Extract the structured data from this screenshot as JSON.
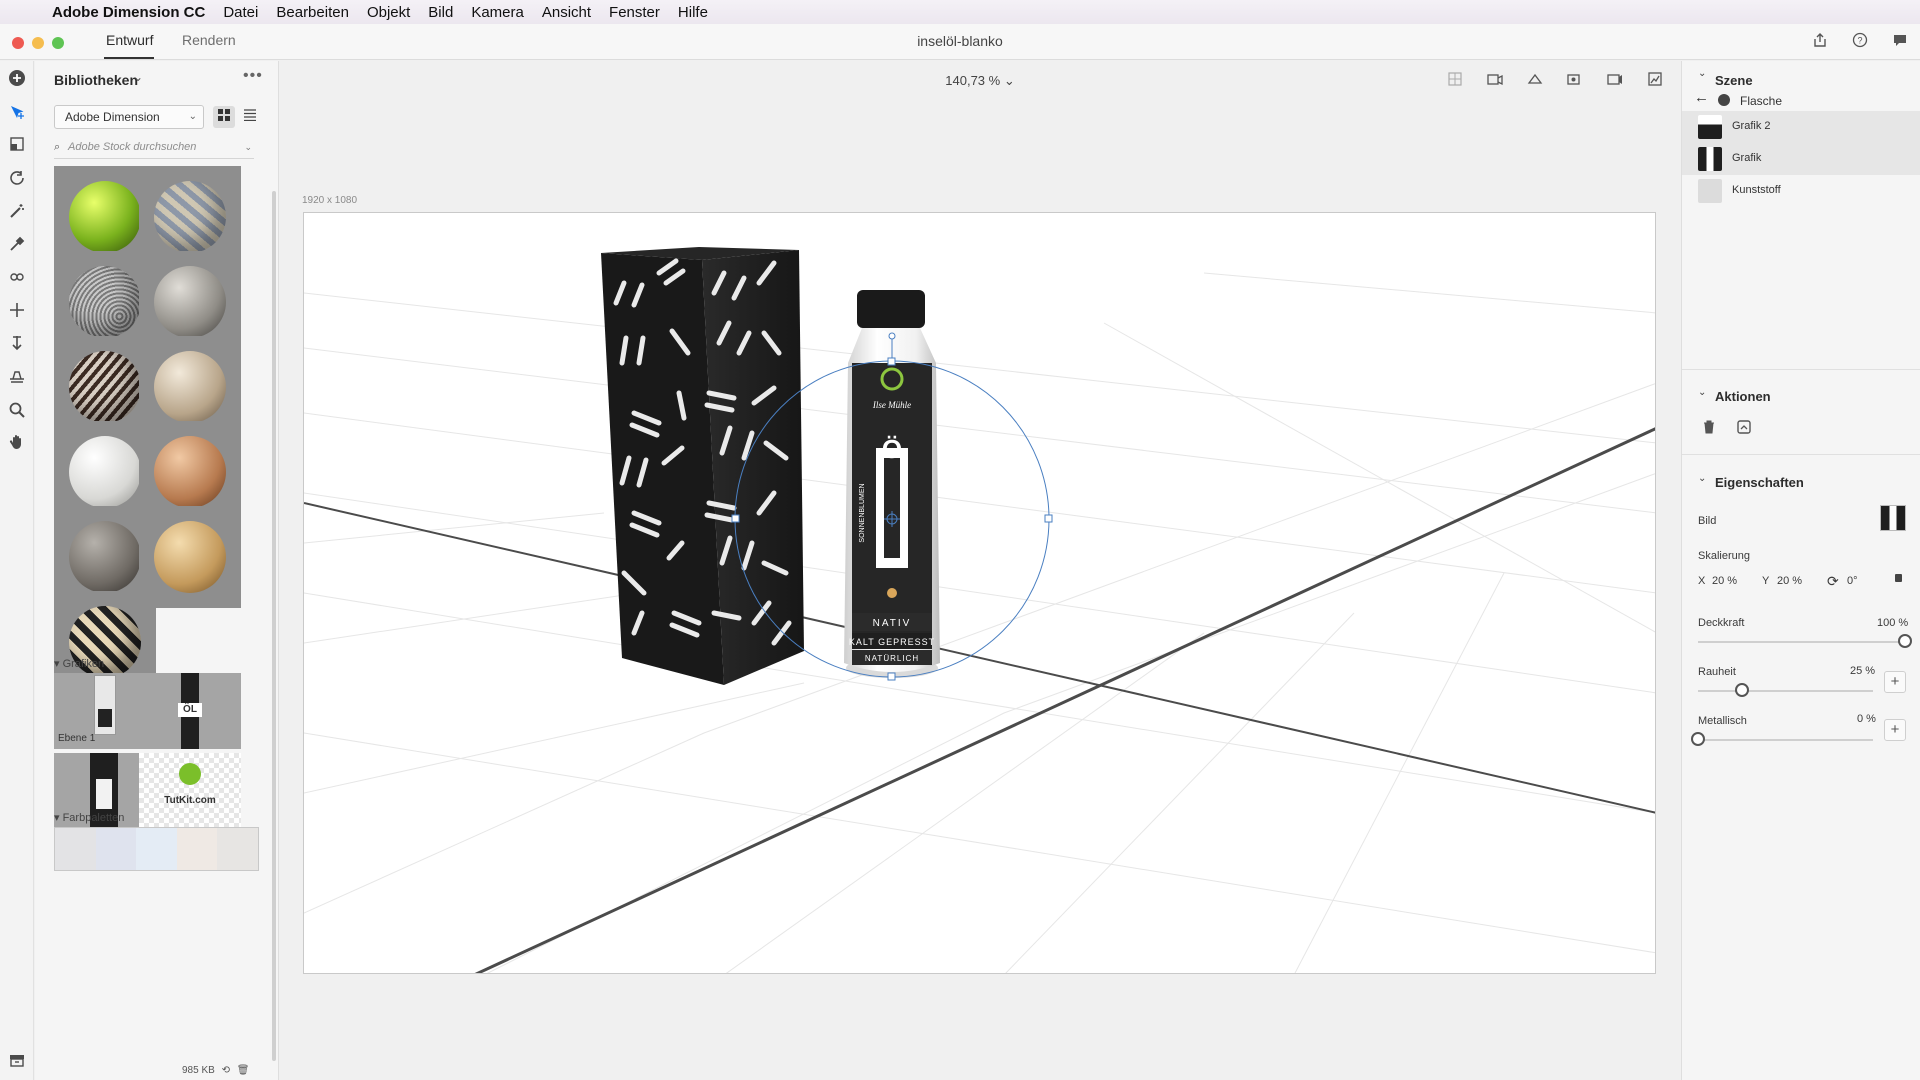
{
  "menubar": {
    "app_name": "Adobe Dimension CC",
    "items": [
      "Datei",
      "Bearbeiten",
      "Objekt",
      "Bild",
      "Kamera",
      "Ansicht",
      "Fenster",
      "Hilfe"
    ]
  },
  "titlebar": {
    "tabs": [
      {
        "label": "Entwurf",
        "active": true
      },
      {
        "label": "Rendern",
        "active": false
      }
    ],
    "document_title": "inselöl-blanko"
  },
  "libraries": {
    "title": "Bibliotheken",
    "source_select": "Adobe Dimension",
    "search_placeholder": "Adobe Stock durchsuchen",
    "sections": {
      "graphics": "Grafiken",
      "palettes": "Farbpaletten"
    },
    "graphic_items": [
      {
        "label": "Ebene 1"
      },
      {
        "label": ""
      },
      {
        "label": ""
      },
      {
        "label": "TutKit.com"
      }
    ],
    "footer_size": "985 KB",
    "palette_colors": [
      "#e3e3e5",
      "#dfe3ee",
      "#e4ecf5",
      "#efe9e4",
      "#e7e5e3"
    ]
  },
  "canvas": {
    "zoom": "140,73 %",
    "doc_size": "1920 x 1080",
    "bottle": {
      "logo_text": "Ilse Mühle",
      "big_letter": "Ö",
      "side_text": "SONNENBLUMEN",
      "band1": "NATIV",
      "band2": "KALT GEPRESST",
      "band3": "NATÜRLICH"
    }
  },
  "scene": {
    "title": "Szene",
    "breadcrumb": "Flasche",
    "layers": [
      {
        "label": "Grafik 2",
        "selected": true
      },
      {
        "label": "Grafik",
        "selected": true
      },
      {
        "label": "Kunststoff",
        "selected": false
      }
    ]
  },
  "actions": {
    "title": "Aktionen"
  },
  "properties": {
    "title": "Eigenschaften",
    "image_label": "Bild",
    "scale_label": "Skalierung",
    "scale_x_label": "X",
    "scale_x": "20 %",
    "scale_y_label": "Y",
    "scale_y": "20 %",
    "rotation": "0°",
    "opacity_label": "Deckkraft",
    "opacity_value": "100 %",
    "opacity": 1.0,
    "roughness_label": "Rauheit",
    "roughness_value": "25 %",
    "roughness": 0.25,
    "metallic_label": "Metallisch",
    "metallic_value": "0 %",
    "metallic": 0.0
  },
  "colors": {
    "accent": "#1473e6",
    "box": "#1f1f1f",
    "selection": "#4a7fc1"
  }
}
